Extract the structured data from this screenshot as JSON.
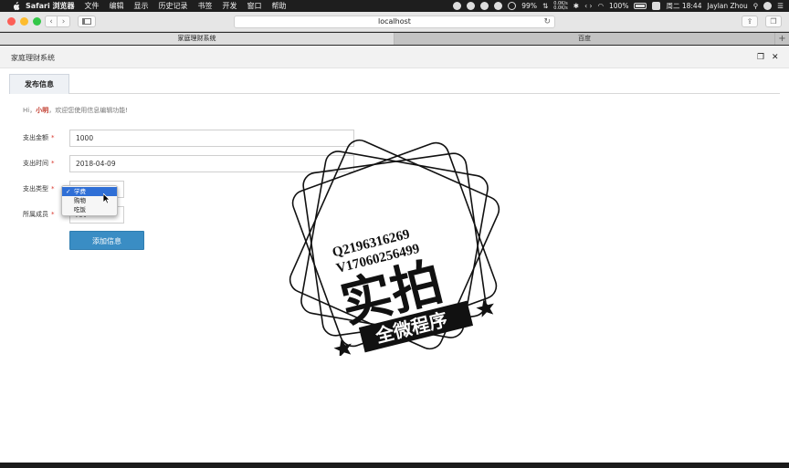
{
  "menubar": {
    "items": [
      "Safari 浏览器",
      "文件",
      "编辑",
      "显示",
      "历史记录",
      "书签",
      "开发",
      "窗口",
      "帮助"
    ],
    "battery_percent_label": "99%",
    "net_up": "0.0K/s",
    "net_down": "0.0K/s",
    "wifi_percent": "100%",
    "datetime": "周二 18:44",
    "user": "Jaylan Zhou"
  },
  "browser": {
    "url": "localhost",
    "tabs": [
      {
        "label": "家庭理财系统",
        "active": true
      },
      {
        "label": "百度",
        "active": false
      }
    ],
    "new_tab": "+"
  },
  "page": {
    "header_title": "家庭理财系统",
    "active_tab": "发布信息",
    "welcome_prefix": "Hi，",
    "welcome_user": "小明",
    "welcome_suffix": "，欢迎您使用信息编辑功能!",
    "form": {
      "amount_label": "支出金额",
      "amount_value": "1000",
      "time_label": "支出时间",
      "time_value": "2018-04-09",
      "type_label": "支出类型",
      "type_options": [
        "学费",
        "购物",
        "吃饭"
      ],
      "type_selected": "学费",
      "member_label": "所属成员",
      "member_value": "儿子",
      "required_mark": "*",
      "submit_label": "添加信息"
    }
  },
  "watermark": {
    "line1": "Q2196316269",
    "line2": "V17060256499",
    "main": "实拍",
    "banner": "全微程序"
  }
}
